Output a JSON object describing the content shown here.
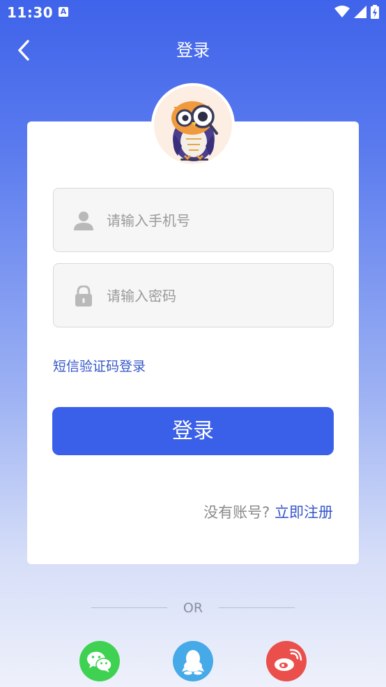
{
  "status_bar": {
    "time": "11:30",
    "app_icon_letter": "A"
  },
  "header": {
    "title": "登录"
  },
  "form": {
    "phone_placeholder": "请输入手机号",
    "password_placeholder": "请输入密码",
    "sms_login_link": "短信验证码登录",
    "login_button": "登录"
  },
  "register": {
    "question": "没有账号?",
    "link": "立即注册"
  },
  "divider": {
    "text": "OR"
  },
  "social": [
    {
      "name": "wechat",
      "icon": "wechat-icon",
      "color": "#3fd252"
    },
    {
      "name": "qq",
      "icon": "qq-icon",
      "color": "#46a9e8"
    },
    {
      "name": "weibo",
      "icon": "weibo-icon",
      "color": "#ea4f4c"
    }
  ],
  "colors": {
    "primary": "#3a5fe8",
    "link": "#3556c9"
  }
}
